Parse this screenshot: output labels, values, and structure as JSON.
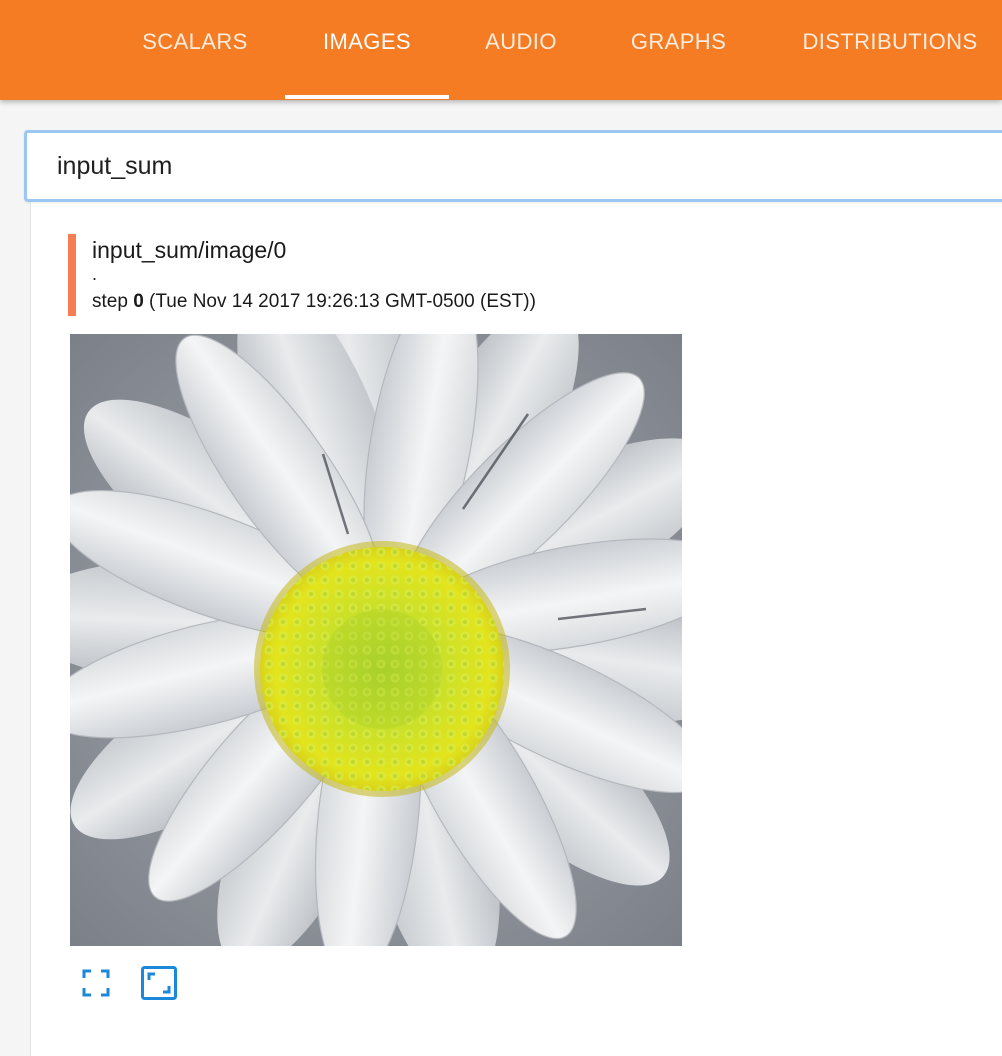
{
  "tabs": [
    {
      "label": "SCALARS",
      "active": false
    },
    {
      "label": "IMAGES",
      "active": true
    },
    {
      "label": "AUDIO",
      "active": false
    },
    {
      "label": "GRAPHS",
      "active": false
    },
    {
      "label": "DISTRIBUTIONS",
      "active": false
    }
  ],
  "search": {
    "value": "input_sum"
  },
  "card": {
    "title": "input_sum/image/0",
    "subtitle": ".",
    "step_prefix": "step ",
    "step_value": "0",
    "step_time": " (Tue Nov 14 2017 19:26:13 GMT-0500 (EST))"
  },
  "image": {
    "subject": "white daisy flower with yellow center"
  },
  "controls": {
    "fullscreen_icon": "fullscreen-icon",
    "fit_icon": "fit-to-view-icon"
  },
  "colors": {
    "accent": "#f57c22",
    "card_marker": "#f57c53",
    "focus_border": "#9bc8f3",
    "control_blue": "#1c88d9"
  }
}
